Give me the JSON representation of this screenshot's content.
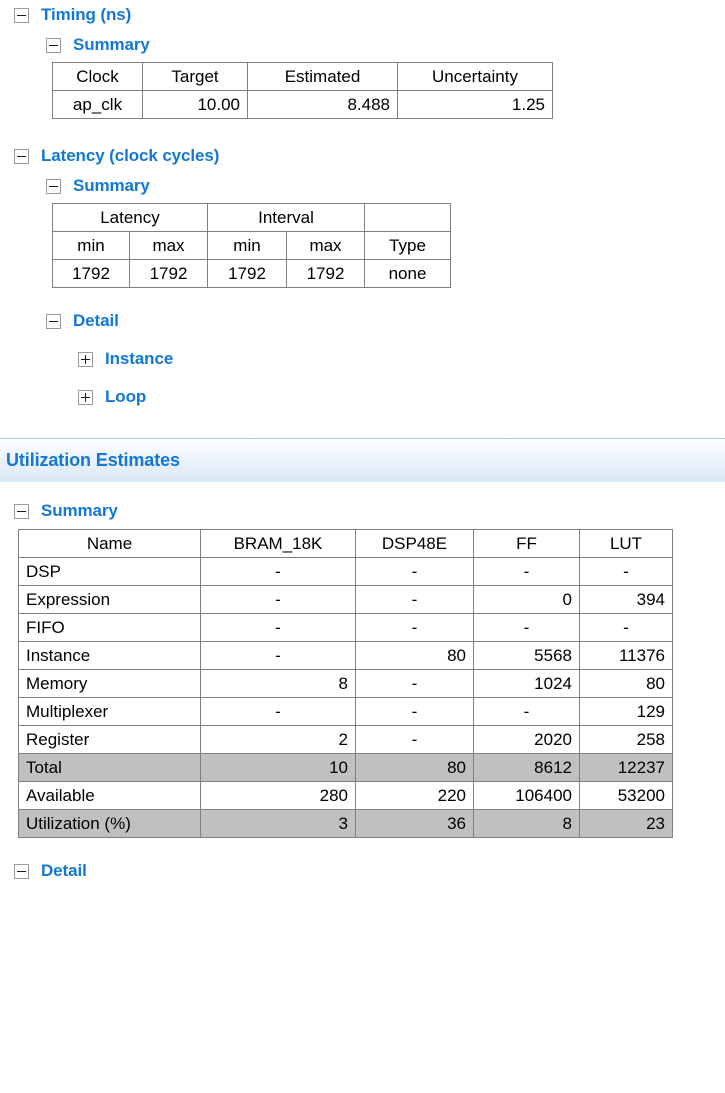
{
  "timing": {
    "heading": "Timing (ns)",
    "summary_heading": "Summary",
    "table": {
      "headers": [
        "Clock",
        "Target",
        "Estimated",
        "Uncertainty"
      ],
      "rows": [
        [
          "ap_clk",
          "10.00",
          "8.488",
          "1.25"
        ]
      ]
    }
  },
  "latency": {
    "heading": "Latency (clock cycles)",
    "summary_heading": "Summary",
    "detail_heading": "Detail",
    "detail_items": [
      {
        "label": "Instance"
      },
      {
        "label": "Loop"
      }
    ],
    "table": {
      "group_headers": [
        "Latency",
        "Interval",
        ""
      ],
      "sub_headers": [
        "min",
        "max",
        "min",
        "max",
        "Type"
      ],
      "rows": [
        [
          "1792",
          "1792",
          "1792",
          "1792",
          "none"
        ]
      ]
    }
  },
  "utilization": {
    "section_heading": "Utilization Estimates",
    "summary_heading": "Summary",
    "detail_heading": "Detail",
    "table": {
      "headers": [
        "Name",
        "BRAM_18K",
        "DSP48E",
        "FF",
        "LUT"
      ],
      "rows": [
        {
          "name": "DSP",
          "values": [
            "-",
            "-",
            "-",
            "-"
          ],
          "shaded": false
        },
        {
          "name": "Expression",
          "values": [
            "-",
            "-",
            "0",
            "394"
          ],
          "shaded": false
        },
        {
          "name": "FIFO",
          "values": [
            "-",
            "-",
            "-",
            "-"
          ],
          "shaded": false
        },
        {
          "name": "Instance",
          "values": [
            "-",
            "80",
            "5568",
            "11376"
          ],
          "shaded": false
        },
        {
          "name": "Memory",
          "values": [
            "8",
            "-",
            "1024",
            "80"
          ],
          "shaded": false
        },
        {
          "name": "Multiplexer",
          "values": [
            "-",
            "-",
            "-",
            "129"
          ],
          "shaded": false
        },
        {
          "name": "Register",
          "values": [
            "2",
            "-",
            "2020",
            "258"
          ],
          "shaded": false
        },
        {
          "name": "Total",
          "values": [
            "10",
            "80",
            "8612",
            "12237"
          ],
          "shaded": true
        },
        {
          "name": "Available",
          "values": [
            "280",
            "220",
            "106400",
            "53200"
          ],
          "shaded": false
        },
        {
          "name": "Utilization (%)",
          "values": [
            "3",
            "36",
            "8",
            "23"
          ],
          "shaded": true
        }
      ]
    }
  },
  "icons": {
    "collapse": "minus-box-icon",
    "expand": "plus-box-icon"
  },
  "colors": {
    "heading_blue": "#1278d4",
    "table_border": "#808080",
    "shaded_row": "#c0c0c0",
    "banner_top": "#ffffff",
    "banner_bottom": "#dce9f7"
  }
}
